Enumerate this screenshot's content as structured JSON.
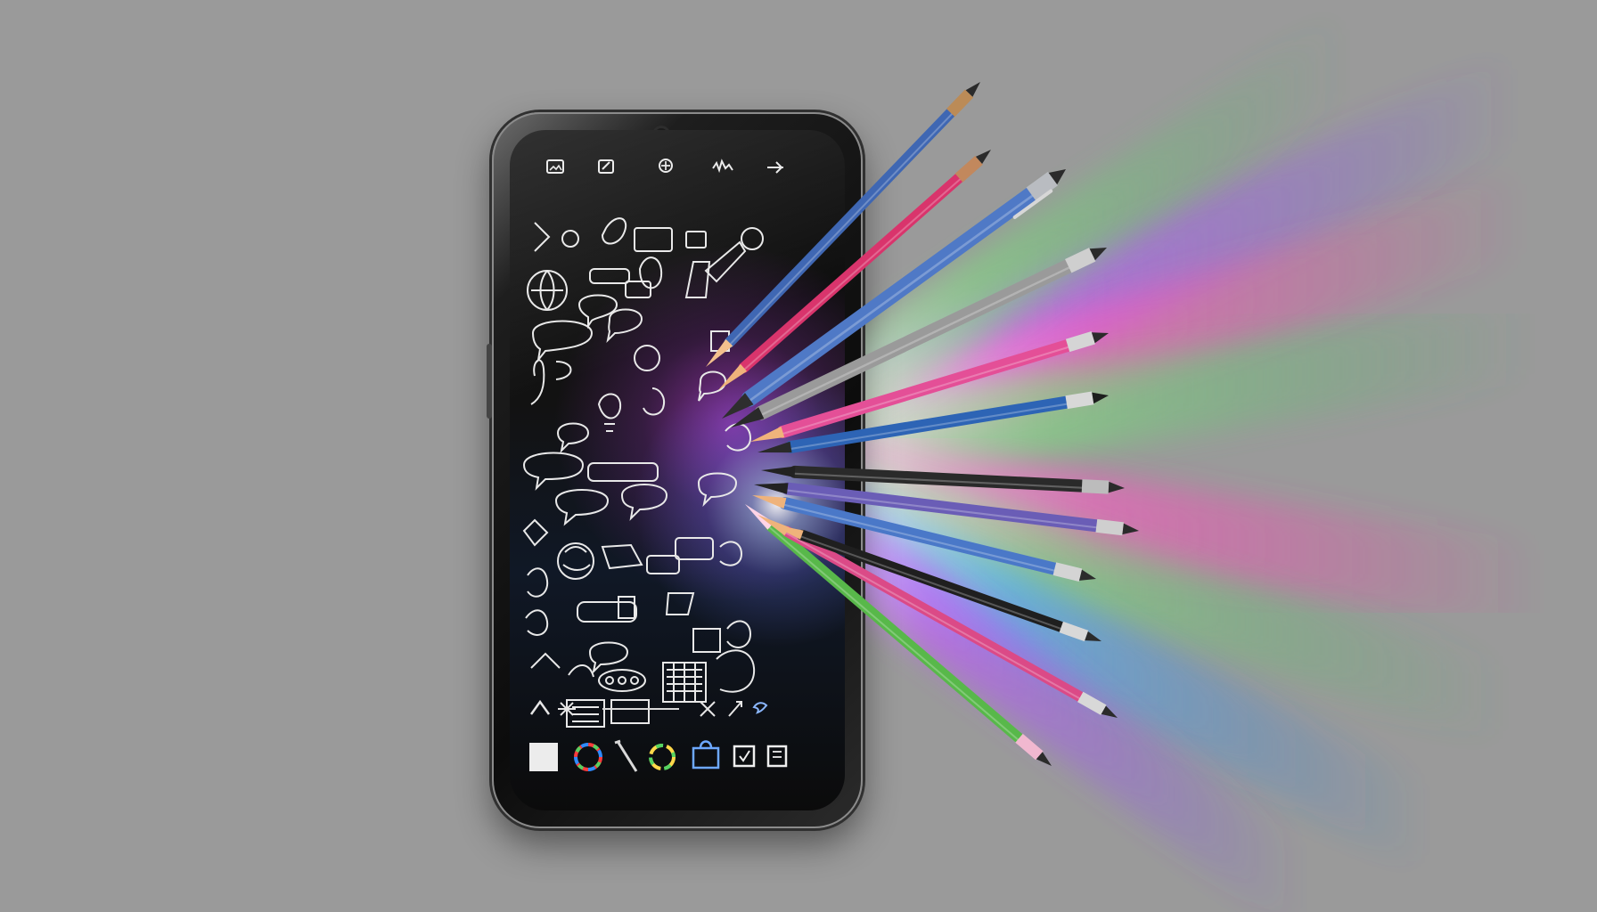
{
  "scene": {
    "background_color": "#9a9a9a",
    "subject": "smartphone-with-sketch-icons-and-drawing-pens",
    "screen": {
      "top_icons": [
        "image-icon",
        "edit-icon",
        "rotate-icon",
        "waveform-icon",
        "arrow-icon"
      ],
      "toolbar_icons": [
        "color-swatch-icon",
        "color-wheel-icon",
        "pen-tool-icon",
        "ring-icon",
        "bag-icon",
        "checkbox-icon",
        "note-icon"
      ],
      "sketch_glyphs": [
        "speech-bubble",
        "globe",
        "lightbulb",
        "chevron",
        "rectangle",
        "circle",
        "ribbon",
        "dialog-box"
      ]
    },
    "pens": [
      {
        "kind": "pencil",
        "color": "#3f67b3"
      },
      {
        "kind": "pencil",
        "color": "#d9346c"
      },
      {
        "kind": "fountain-pen",
        "color": "#4f79c6"
      },
      {
        "kind": "stylus",
        "color": "#9a9a9a"
      },
      {
        "kind": "pencil",
        "color": "#e44f97"
      },
      {
        "kind": "brush",
        "color": "#2d64b5"
      },
      {
        "kind": "marker",
        "color": "#2a2a2a"
      },
      {
        "kind": "marker",
        "color": "#6a5db6"
      },
      {
        "kind": "pencil",
        "color": "#4a78c8"
      },
      {
        "kind": "pencil",
        "color": "#58b84a"
      },
      {
        "kind": "pencil",
        "color": "#db4a87"
      },
      {
        "kind": "pencil",
        "color": "#1f1f1f"
      }
    ],
    "ray_colors": [
      "#c45cff",
      "#ff56c4",
      "#6fd96f",
      "#4fb3ff",
      "#a5d06f",
      "#8c84ff",
      "#ffb0f0"
    ]
  }
}
